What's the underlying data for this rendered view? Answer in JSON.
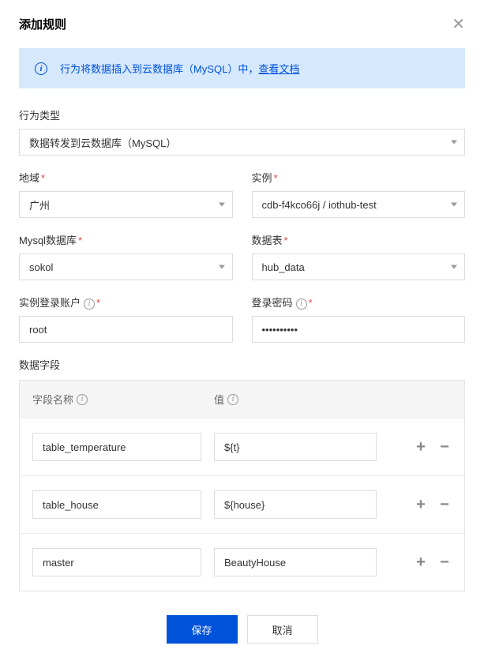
{
  "modal": {
    "title": "添加规则"
  },
  "banner": {
    "text_prefix": "行为将数据插入到云数据库（MySQL）中，",
    "link": "查看文档"
  },
  "labels": {
    "action_type": "行为类型",
    "region": "地域",
    "instance": "实例",
    "mysql_db": "Mysql数据库",
    "table": "数据表",
    "login_user": "实例登录账户",
    "login_pass": "登录密码",
    "data_fields": "数据字段",
    "field_name": "字段名称",
    "field_value": "值"
  },
  "values": {
    "action_type": "数据转发到云数据库（MySQL）",
    "region": "广州",
    "instance": "cdb-f4kco66j / iothub-test",
    "mysql_db": "sokol",
    "table": "hub_data",
    "login_user": "root",
    "login_pass": "••••••••••"
  },
  "fields": [
    {
      "name": "table_temperature",
      "value": "${t}"
    },
    {
      "name": "table_house",
      "value": "${house}"
    },
    {
      "name": "master",
      "value": "BeautyHouse"
    }
  ],
  "buttons": {
    "save": "保存",
    "cancel": "取消"
  }
}
